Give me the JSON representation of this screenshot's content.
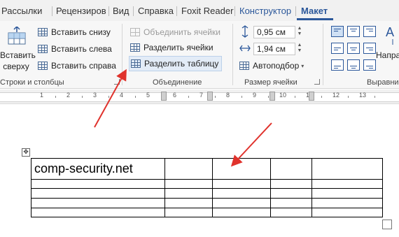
{
  "tabs": [
    "Рассылки",
    "Рецензиров",
    "Вид",
    "Справка",
    "Foxit Reader",
    "Конструктор",
    "Макет"
  ],
  "active_tab": "Макет",
  "ribbon": {
    "rows_cols": {
      "insert_label_line1": "вставить",
      "insert_label_line2": "сверху",
      "insert_below": "Вставить снизу",
      "insert_left": "Вставить слева",
      "insert_right": "Вставить справа",
      "group_label": "Строки и столбцы"
    },
    "merge": {
      "merge_cells": "Объединить ячейки",
      "split_cells": "Разделить ячейки",
      "split_table": "Разделить таблицу",
      "group_label": "Объединение"
    },
    "cell_size": {
      "height_value": "0,95 см",
      "width_value": "1,94 см",
      "autofit": "Автоподбор",
      "group_label": "Размер ячейки"
    },
    "alignment": {
      "direction_label": "Напра",
      "group_label": "Выравни"
    }
  },
  "ruler": {
    "numbers": [
      "1",
      "2",
      "3",
      "4",
      "5",
      "6",
      "7",
      "8",
      "9",
      "10",
      "11",
      "12",
      "13"
    ]
  },
  "document": {
    "table_cell_text": "comp-security.net"
  },
  "colors": {
    "accent": "#2b579a",
    "arrow": "#e0322c"
  }
}
